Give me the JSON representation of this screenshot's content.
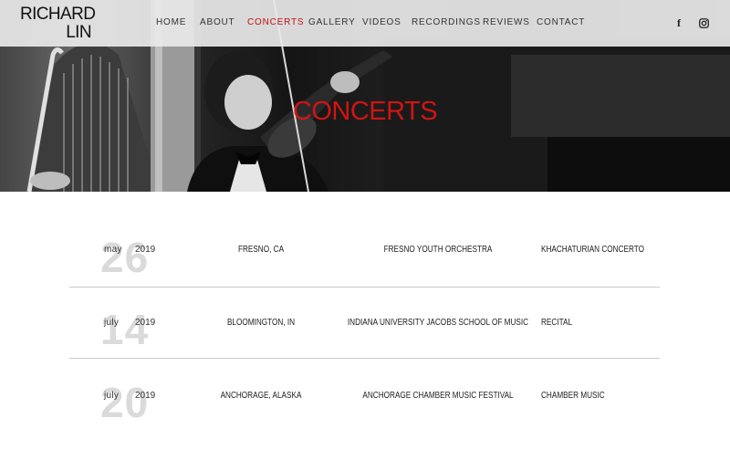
{
  "logo": {
    "line1": "RICHARD",
    "line2": "LIN"
  },
  "nav": {
    "items": [
      {
        "label": "HOME"
      },
      {
        "label": "ABOUT"
      },
      {
        "label": "CONCERTS",
        "active": true
      },
      {
        "label": "GALLERY"
      },
      {
        "label": "VIDEOS"
      },
      {
        "label": "RECORDINGS"
      },
      {
        "label": "REVIEWS"
      },
      {
        "label": "CONTACT"
      }
    ],
    "social": [
      {
        "icon": "facebook-icon",
        "glyph": "f"
      },
      {
        "icon": "instagram-icon"
      }
    ]
  },
  "hero": {
    "title": "CONCERTS"
  },
  "colors": {
    "accent": "#d11414",
    "header_bg": "#e8e8e8",
    "divider": "#c9c9c9",
    "day_gray": "#dadada"
  },
  "concerts": [
    {
      "day": "26",
      "month": "may",
      "year": "2019",
      "location": "FRESNO, CA",
      "organization": "FRESNO YOUTH ORCHESTRA",
      "program": "KHACHATURIAN CONCERTO"
    },
    {
      "day": "14",
      "month": "july",
      "year": "2019",
      "location": "BLOOMINGTON, IN",
      "organization": "INDIANA UNIVERSITY JACOBS SCHOOL OF MUSIC",
      "program": "RECITAL"
    },
    {
      "day": "20",
      "month": "july",
      "year": "2019",
      "location": "ANCHORAGE, ALASKA",
      "organization": "ANCHORAGE CHAMBER MUSIC FESTIVAL",
      "program": "CHAMBER MUSIC"
    }
  ]
}
